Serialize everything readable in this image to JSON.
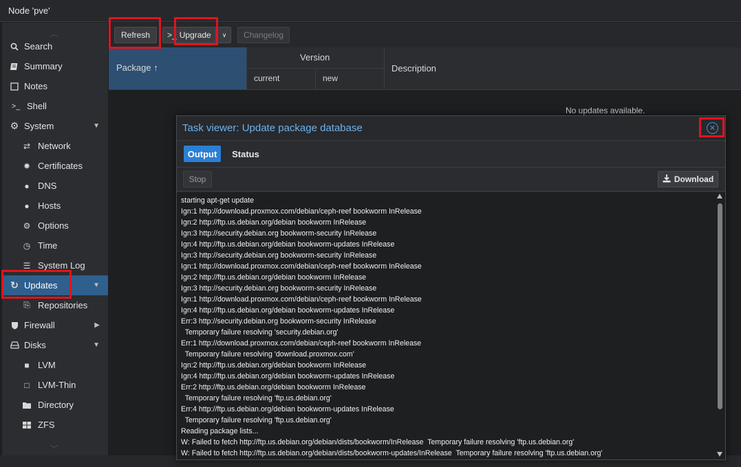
{
  "topbar": {
    "title": "Node 'pve'"
  },
  "sidebar": {
    "items": [
      {
        "label": "Search",
        "icon": "search-icon",
        "glyph": "🔍"
      },
      {
        "label": "Summary",
        "icon": "book-icon",
        "glyph": "▤"
      },
      {
        "label": "Notes",
        "icon": "notes-icon",
        "glyph": "☐"
      },
      {
        "label": "Shell",
        "icon": "terminal-icon",
        "glyph": ">_"
      },
      {
        "label": "System",
        "icon": "gears-icon",
        "glyph": "⚙"
      },
      {
        "label": "Network",
        "icon": "network-icon",
        "glyph": "⇄"
      },
      {
        "label": "Certificates",
        "icon": "certificate-icon",
        "glyph": "✹"
      },
      {
        "label": "DNS",
        "icon": "globe-icon",
        "glyph": "●"
      },
      {
        "label": "Hosts",
        "icon": "globe-icon",
        "glyph": "●"
      },
      {
        "label": "Options",
        "icon": "gear-icon",
        "glyph": "⚙"
      },
      {
        "label": "Time",
        "icon": "clock-icon",
        "glyph": "◷"
      },
      {
        "label": "System Log",
        "icon": "list-icon",
        "glyph": "☰"
      },
      {
        "label": "Updates",
        "icon": "refresh-icon",
        "glyph": "↻"
      },
      {
        "label": "Repositories",
        "icon": "repository-icon",
        "glyph": "⎘"
      },
      {
        "label": "Firewall",
        "icon": "shield-icon",
        "glyph": "▼"
      },
      {
        "label": "Disks",
        "icon": "hdd-icon",
        "glyph": "⬭"
      },
      {
        "label": "LVM",
        "icon": "square-icon",
        "glyph": "■"
      },
      {
        "label": "LVM-Thin",
        "icon": "square-outline-icon",
        "glyph": "□"
      },
      {
        "label": "Directory",
        "icon": "folder-icon",
        "glyph": "▬"
      },
      {
        "label": "ZFS",
        "icon": "grid-icon",
        "glyph": "▦"
      }
    ]
  },
  "toolbar": {
    "refresh_label": "Refresh",
    "upgrade_label": "Upgrade",
    "upgrade_prefix": ">_",
    "changelog_label": "Changelog"
  },
  "grid": {
    "package_header": "Package ↑",
    "version_header": "Version",
    "current_header": "current",
    "new_header": "new",
    "description_header": "Description",
    "empty_text": "No updates available."
  },
  "modal": {
    "title": "Task viewer: Update package database",
    "tabs": [
      "Output",
      "Status"
    ],
    "stop_label": "Stop",
    "download_label": "Download",
    "log_lines": [
      "starting apt-get update",
      "Ign:1 http://download.proxmox.com/debian/ceph-reef bookworm InRelease",
      "Ign:2 http://ftp.us.debian.org/debian bookworm InRelease",
      "Ign:3 http://security.debian.org bookworm-security InRelease",
      "Ign:4 http://ftp.us.debian.org/debian bookworm-updates InRelease",
      "Ign:3 http://security.debian.org bookworm-security InRelease",
      "Ign:1 http://download.proxmox.com/debian/ceph-reef bookworm InRelease",
      "Ign:2 http://ftp.us.debian.org/debian bookworm InRelease",
      "Ign:3 http://security.debian.org bookworm-security InRelease",
      "Ign:1 http://download.proxmox.com/debian/ceph-reef bookworm InRelease",
      "Ign:4 http://ftp.us.debian.org/debian bookworm-updates InRelease",
      "Err:3 http://security.debian.org bookworm-security InRelease",
      "  Temporary failure resolving 'security.debian.org'",
      "Err:1 http://download.proxmox.com/debian/ceph-reef bookworm InRelease",
      "  Temporary failure resolving 'download.proxmox.com'",
      "Ign:2 http://ftp.us.debian.org/debian bookworm InRelease",
      "Ign:4 http://ftp.us.debian.org/debian bookworm-updates InRelease",
      "Err:2 http://ftp.us.debian.org/debian bookworm InRelease",
      "  Temporary failure resolving 'ftp.us.debian.org'",
      "Err:4 http://ftp.us.debian.org/debian bookworm-updates InRelease",
      "  Temporary failure resolving 'ftp.us.debian.org'",
      "Reading package lists...",
      "W: Failed to fetch http://ftp.us.debian.org/debian/dists/bookworm/InRelease  Temporary failure resolving 'ftp.us.debian.org'",
      "W: Failed to fetch http://ftp.us.debian.org/debian/dists/bookworm-updates/InRelease  Temporary failure resolving 'ftp.us.debian.org'"
    ]
  },
  "colors": {
    "accent": "#2b7fd6",
    "active_nav": "#2f5f8d",
    "highlight_box": "#e0141e",
    "modal_title": "#6fb1e8"
  }
}
